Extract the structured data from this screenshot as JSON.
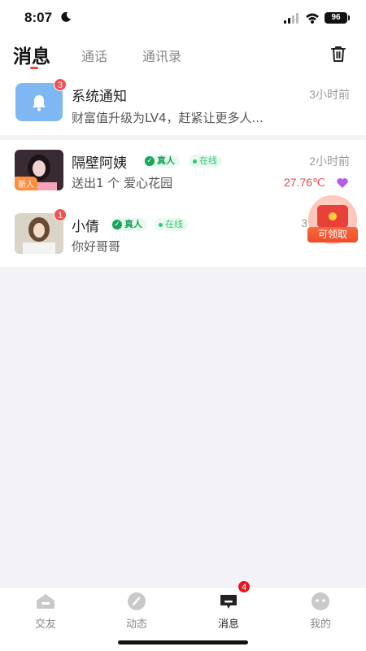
{
  "status_bar": {
    "time": "8:07",
    "battery": "96"
  },
  "header": {
    "tabs": [
      {
        "label": "消息",
        "active": true
      },
      {
        "label": "通话",
        "active": false
      },
      {
        "label": "通讯录",
        "active": false
      }
    ],
    "trash_icon": "trash-icon"
  },
  "system_notice": {
    "title": "系统通知",
    "badge": "3",
    "preview": "财富值升级为LV4，赶紧让更多人...",
    "time": "3小时前",
    "icon": "bell-icon"
  },
  "conversations": [
    {
      "name": "隔壁阿姨",
      "verified_label": "真人",
      "online_label": "在线",
      "time": "2小时前",
      "preview": "送出1 个 爱心花园",
      "avatar_tag": "新人",
      "temperature": "27.76℃"
    },
    {
      "name": "小倩",
      "verified_label": "真人",
      "online_label": "在线",
      "time": "3",
      "preview": "你好哥哥",
      "badge": "1"
    }
  ],
  "reward": {
    "label": "可领取"
  },
  "bottom_nav": {
    "items": [
      {
        "label": "交友",
        "icon": "friends-icon"
      },
      {
        "label": "动态",
        "icon": "moments-icon"
      },
      {
        "label": "消息",
        "icon": "message-icon",
        "badge": "4"
      },
      {
        "label": "我的",
        "icon": "profile-icon"
      }
    ]
  },
  "colors": {
    "accent": "#f14a3e",
    "online_green": "#35c676",
    "verified_green": "#1aa35a",
    "temp_red": "#e8474b"
  }
}
